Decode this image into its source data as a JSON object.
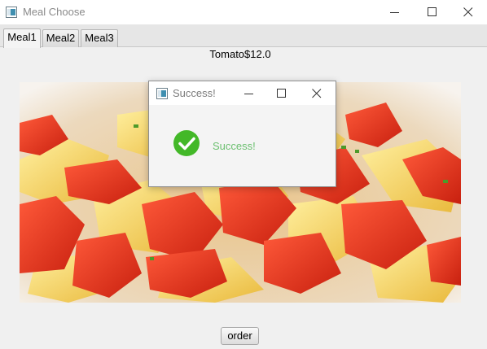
{
  "window": {
    "title": "Meal Choose",
    "icon": "java-app-icon",
    "controls": [
      "minimize-icon",
      "maximize-icon",
      "close-icon"
    ]
  },
  "tabs": [
    {
      "label": "Meal1",
      "active": true
    },
    {
      "label": "Meal2",
      "active": false
    },
    {
      "label": "Meal3",
      "active": false
    }
  ],
  "meal": {
    "label": "Tomato$12.0",
    "image": "tomato-scrambled-eggs-photo"
  },
  "order_button": {
    "label": "order"
  },
  "dialog": {
    "title": "Success!",
    "message": "Success!",
    "icon": "success-check-icon",
    "accent": "#43b828"
  },
  "colors": {
    "tomato": "#e0301e",
    "egg": "#f3d35a",
    "success_text": "#6cc070"
  }
}
